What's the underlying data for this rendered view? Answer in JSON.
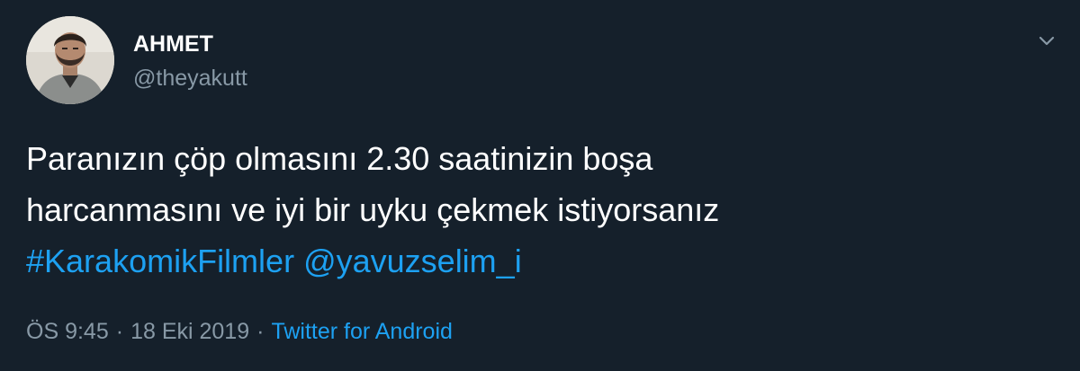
{
  "tweet": {
    "display_name": "AHMET",
    "handle": "@theyakutt",
    "text_line1": "Paranızın çöp olmasını 2.30 saatinizin boşa",
    "text_line2": "harcanmasını ve iyi bir uyku çekmek istiyorsanız",
    "hashtag": "#KarakomikFilmler",
    "mention": "@yavuzselim_i",
    "time": "ÖS 9:45",
    "separator": "·",
    "date": "18 Eki 2019",
    "source": "Twitter for Android"
  },
  "icons": {
    "menu": "chevron-down-icon",
    "avatar": "profile-photo"
  },
  "colors": {
    "background": "#15202b",
    "text": "#ffffff",
    "secondary": "#8899a6",
    "link": "#1da1f2"
  }
}
